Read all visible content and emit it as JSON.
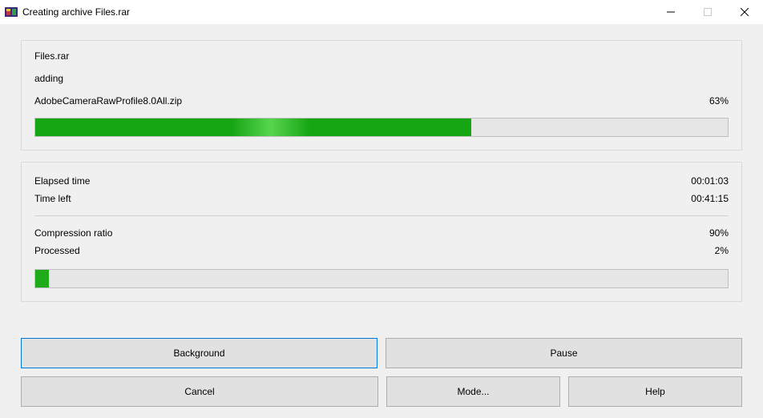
{
  "titlebar": {
    "title": "Creating archive Files.rar"
  },
  "progress_panel": {
    "archive_name": "Files.rar",
    "action": "adding",
    "current_file": "AdobeCameraRawProfile8.0All.zip",
    "file_percent": "63%",
    "file_percent_value": 63
  },
  "stats_panel": {
    "elapsed_label": "Elapsed time",
    "elapsed_value": "00:01:03",
    "timeleft_label": "Time left",
    "timeleft_value": "00:41:15",
    "ratio_label": "Compression ratio",
    "ratio_value": "90%",
    "processed_label": "Processed",
    "processed_value": "2%",
    "processed_percent_value": 2
  },
  "buttons": {
    "background": "Background",
    "pause": "Pause",
    "cancel": "Cancel",
    "mode": "Mode...",
    "help": "Help"
  }
}
